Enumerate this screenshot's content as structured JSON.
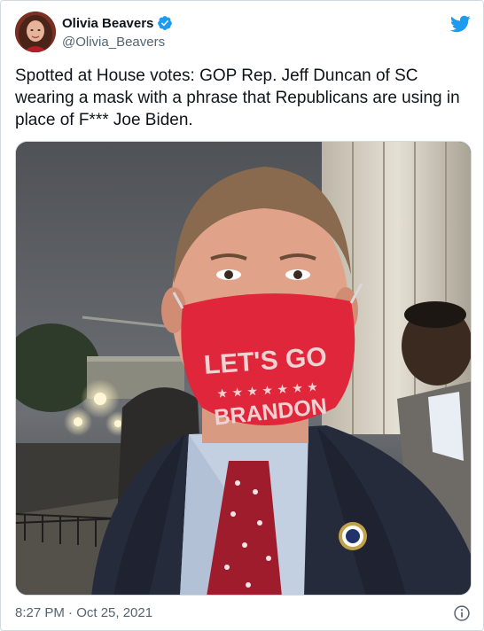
{
  "author": {
    "display_name": "Olivia Beavers",
    "handle": "@Olivia_Beavers",
    "verified": true
  },
  "tweet": {
    "text": "Spotted at House votes: GOP Rep. Jeff Duncan of SC wearing a mask with a phrase that Republicans are using in place of F*** Joe Biden.",
    "timestamp": "8:27 PM · Oct 25, 2021"
  },
  "media": {
    "mask_line1": "LET'S GO",
    "mask_line2": "BRANDON",
    "mask_stars": "★ ★ ★ ★ ★ ★ ★"
  },
  "icons": {
    "verified": "verified-badge-icon",
    "twitter": "twitter-bird-icon",
    "info": "info-icon"
  },
  "colors": {
    "twitter_blue": "#1d9bf0",
    "mask_red": "#e0263a",
    "text_secondary": "#536471"
  }
}
